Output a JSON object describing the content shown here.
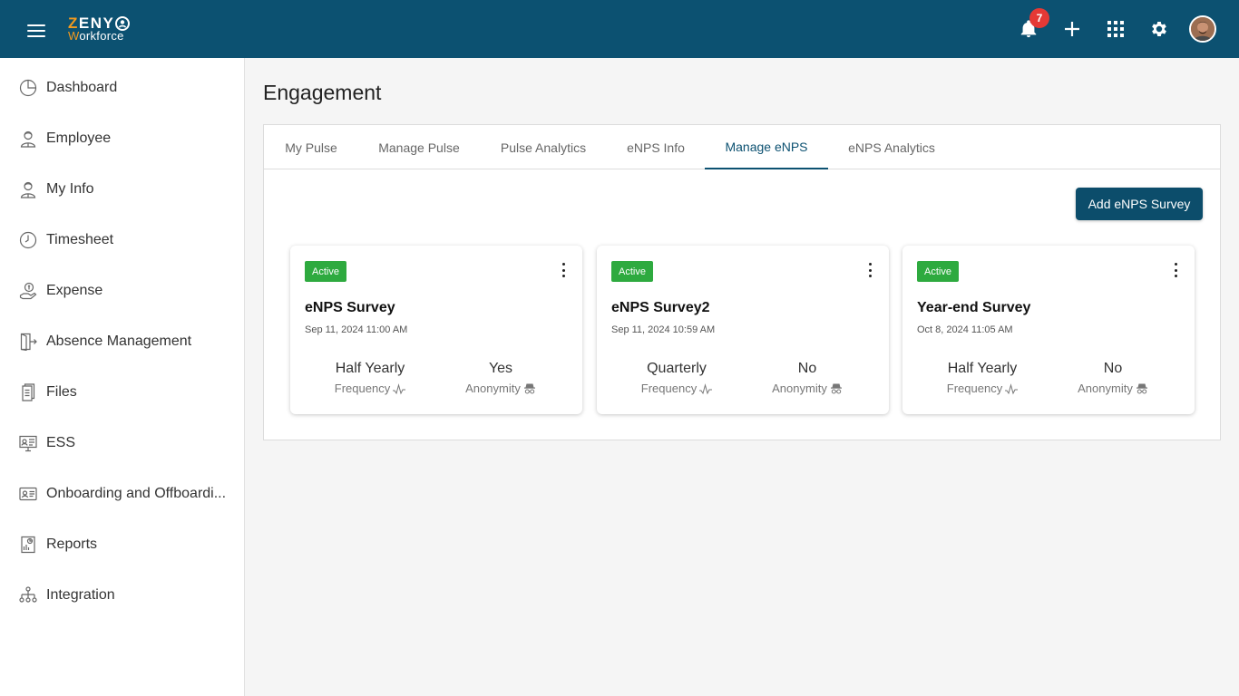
{
  "header": {
    "logo_word": "ZENY",
    "logo_sub_first": "W",
    "logo_sub_rest": "orkforce",
    "notification_count": "7"
  },
  "sidebar": {
    "items": [
      {
        "label": "Dashboard",
        "icon": "pie-chart-icon"
      },
      {
        "label": "Employee",
        "icon": "person-icon"
      },
      {
        "label": "My Info",
        "icon": "person-icon"
      },
      {
        "label": "Timesheet",
        "icon": "clock-icon"
      },
      {
        "label": "Expense",
        "icon": "money-hand-icon"
      },
      {
        "label": "Absence Management",
        "icon": "exit-door-icon"
      },
      {
        "label": "Files",
        "icon": "file-icon"
      },
      {
        "label": "ESS",
        "icon": "monitor-icon"
      },
      {
        "label": "Onboarding and Offboardi...",
        "icon": "id-card-icon"
      },
      {
        "label": "Reports",
        "icon": "report-icon"
      },
      {
        "label": "Integration",
        "icon": "hierarchy-icon"
      }
    ]
  },
  "main": {
    "title": "Engagement",
    "tabs": [
      {
        "label": "My Pulse",
        "active": false
      },
      {
        "label": "Manage Pulse",
        "active": false
      },
      {
        "label": "Pulse Analytics",
        "active": false
      },
      {
        "label": "eNPS Info",
        "active": false
      },
      {
        "label": "Manage eNPS",
        "active": true
      },
      {
        "label": "eNPS Analytics",
        "active": false
      }
    ],
    "add_button": "Add eNPS Survey",
    "cards": [
      {
        "status": "Active",
        "name": "eNPS Survey",
        "date": "Sep 11, 2024  11:00 AM",
        "frequency": "Half Yearly",
        "frequency_label": "Frequency",
        "anonymity": "Yes",
        "anonymity_label": "Anonymity"
      },
      {
        "status": "Active",
        "name": "eNPS Survey2",
        "date": "Sep 11, 2024  10:59 AM",
        "frequency": "Quarterly",
        "frequency_label": "Frequency",
        "anonymity": "No",
        "anonymity_label": "Anonymity"
      },
      {
        "status": "Active",
        "name": "Year-end Survey",
        "date": "Oct 8, 2024  11:05 AM",
        "frequency": "Half Yearly",
        "frequency_label": "Frequency",
        "anonymity": "No",
        "anonymity_label": "Anonymity"
      }
    ]
  },
  "colors": {
    "header_bg": "#0c5171",
    "brand_orange": "#f39a1e",
    "active_badge": "#2eaa3f",
    "notification_badge": "#e53935",
    "button_bg": "#0c4d6b"
  }
}
